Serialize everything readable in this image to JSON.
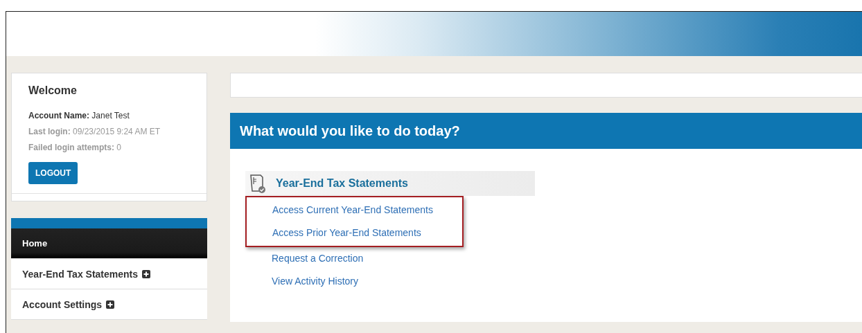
{
  "welcome": {
    "title": "Welcome",
    "account_label": "Account Name:",
    "account_name": "Janet Test",
    "last_login_label": "Last login:",
    "last_login": "09/23/2015 9:24 AM ET",
    "failed_label": "Failed login attempts:",
    "failed": "0",
    "logout": "LOGOUT"
  },
  "nav": [
    {
      "label": "Home",
      "selected": true,
      "expandable": false
    },
    {
      "label": "Year-End Tax Statements",
      "selected": false,
      "expandable": true
    },
    {
      "label": "Account Settings",
      "selected": false,
      "expandable": true
    }
  ],
  "banner": {
    "title": "What would you like to do today?"
  },
  "section": {
    "title": "Year-End Tax Statements"
  },
  "links": [
    {
      "label": "Access Current Year-End Statements",
      "highlighted": true
    },
    {
      "label": "Access Prior Year-End Statements",
      "highlighted": true
    },
    {
      "label": "Request a Correction",
      "highlighted": false
    },
    {
      "label": "View Activity History",
      "highlighted": false
    }
  ]
}
